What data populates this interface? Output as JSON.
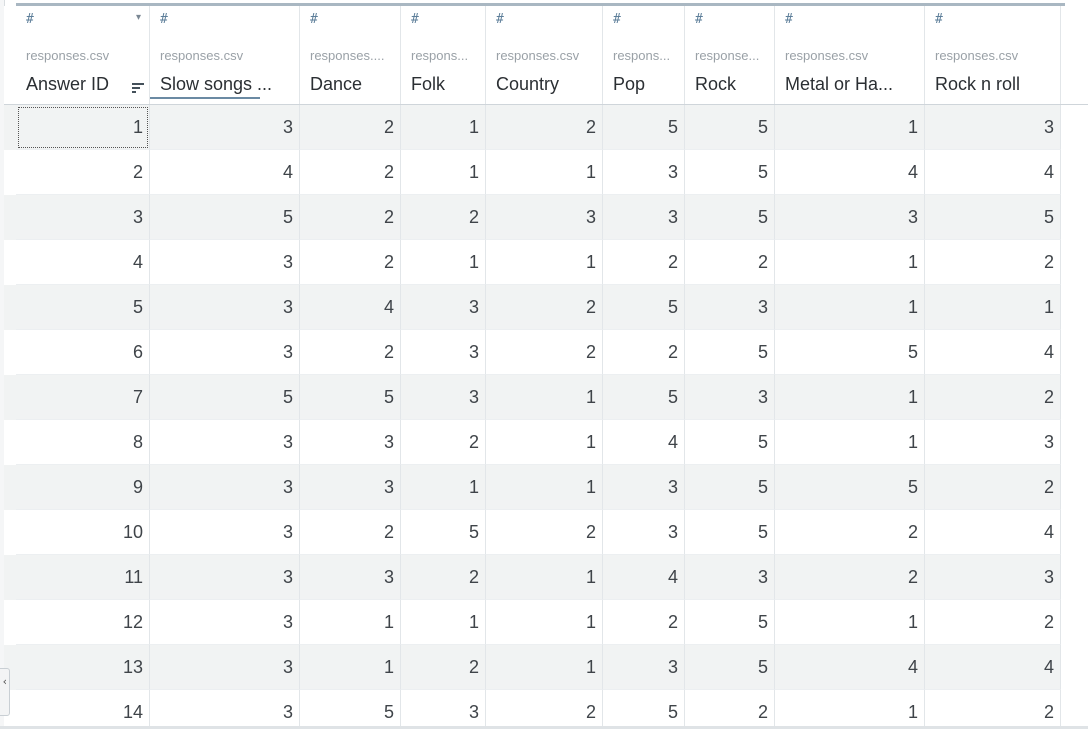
{
  "columns": [
    {
      "name": "Answer ID",
      "source": "responses.csv",
      "type_icon": "#"
    },
    {
      "name": "Slow songs ...",
      "source": "responses.csv",
      "type_icon": "#"
    },
    {
      "name": "Dance",
      "source": "responses....",
      "type_icon": "#"
    },
    {
      "name": "Folk",
      "source": "respons...",
      "type_icon": "#"
    },
    {
      "name": "Country",
      "source": "responses.csv",
      "type_icon": "#"
    },
    {
      "name": "Pop",
      "source": "respons...",
      "type_icon": "#"
    },
    {
      "name": "Rock",
      "source": "response...",
      "type_icon": "#"
    },
    {
      "name": "Metal or Ha...",
      "source": "responses.csv",
      "type_icon": "#"
    },
    {
      "name": "Rock n roll",
      "source": "responses.csv",
      "type_icon": "#"
    }
  ],
  "rows": [
    [
      "1",
      "3",
      "2",
      "1",
      "2",
      "5",
      "5",
      "1",
      "3"
    ],
    [
      "2",
      "4",
      "2",
      "1",
      "1",
      "3",
      "5",
      "4",
      "4"
    ],
    [
      "3",
      "5",
      "2",
      "2",
      "3",
      "3",
      "5",
      "3",
      "5"
    ],
    [
      "4",
      "3",
      "2",
      "1",
      "1",
      "2",
      "2",
      "1",
      "2"
    ],
    [
      "5",
      "3",
      "4",
      "3",
      "2",
      "5",
      "3",
      "1",
      "1"
    ],
    [
      "6",
      "3",
      "2",
      "3",
      "2",
      "2",
      "5",
      "5",
      "4"
    ],
    [
      "7",
      "5",
      "5",
      "3",
      "1",
      "5",
      "3",
      "1",
      "2"
    ],
    [
      "8",
      "3",
      "3",
      "2",
      "1",
      "4",
      "5",
      "1",
      "3"
    ],
    [
      "9",
      "3",
      "3",
      "1",
      "1",
      "3",
      "5",
      "5",
      "2"
    ],
    [
      "10",
      "3",
      "2",
      "5",
      "2",
      "3",
      "5",
      "2",
      "4"
    ],
    [
      "11",
      "3",
      "3",
      "2",
      "1",
      "4",
      "3",
      "2",
      "3"
    ],
    [
      "12",
      "3",
      "1",
      "1",
      "1",
      "2",
      "5",
      "1",
      "2"
    ],
    [
      "13",
      "3",
      "1",
      "2",
      "1",
      "3",
      "5",
      "4",
      "4"
    ],
    [
      "14",
      "3",
      "5",
      "3",
      "2",
      "5",
      "2",
      "1",
      "2"
    ]
  ],
  "icons": {
    "column_menu": "chevron-down-icon",
    "sort": "sort-icon",
    "numeric_type": "number-type-icon",
    "collapse": "chevron-left-icon"
  },
  "colors": {
    "alt_row": "#f1f3f3",
    "type_icon": "#5e7f9a",
    "accent_bar": "#a9b7c2"
  }
}
